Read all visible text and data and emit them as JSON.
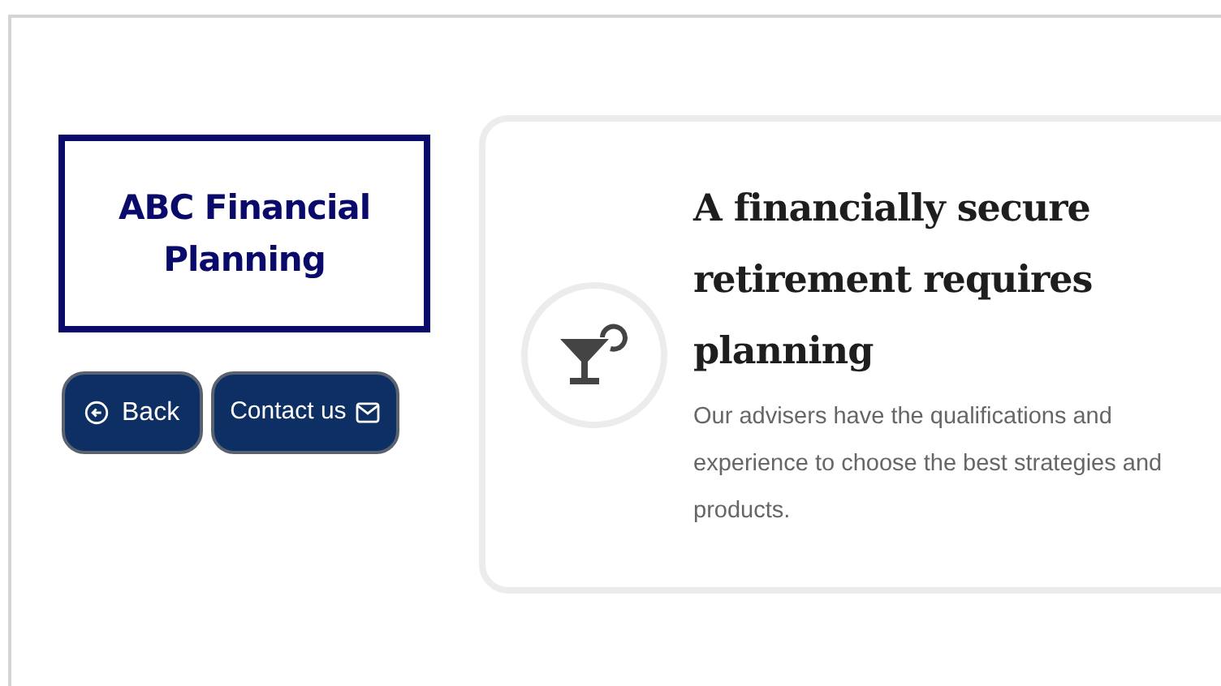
{
  "brand": {
    "title": "ABC Financial Planning"
  },
  "buttons": [
    {
      "kind": "back",
      "label": "Back"
    },
    {
      "kind": "contact",
      "label": "Contact us"
    }
  ],
  "feature": {
    "title": "A financially secure retirement requires planning",
    "description": "Our advisers have the qualifications and experience to choose the best strategies and products."
  }
}
